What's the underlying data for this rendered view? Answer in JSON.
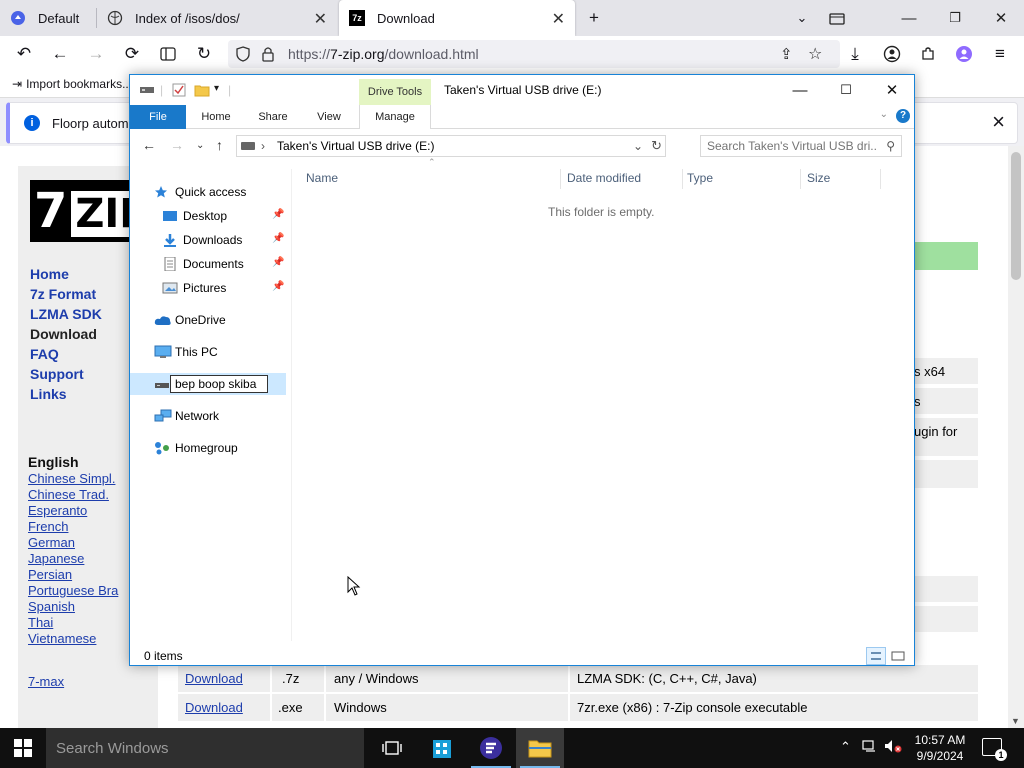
{
  "browser": {
    "tabs": [
      {
        "label": "Default"
      },
      {
        "label": "Index of /isos/dos/"
      },
      {
        "label": "Download"
      }
    ],
    "url_prefix": "https://",
    "url_domain": "7-zip.org",
    "url_path": "/download.html",
    "bookmarks_import": "Import bookmarks...",
    "notification": "Floorp automati"
  },
  "page": {
    "logo_text": "7ZIP",
    "nav": [
      "Home",
      "7z Format",
      "LZMA SDK",
      "Download",
      "FAQ",
      "Support",
      "Links"
    ],
    "languages_title": "English",
    "languages": [
      "Chinese Simpl.",
      "Chinese Trad.",
      "Esperanto",
      "French",
      "German",
      "Japanese",
      "Persian",
      "Portuguese Bra",
      "Spanish",
      "Thai",
      "Vietnamese"
    ],
    "sevenmax": "7-max",
    "peek": [
      "s x64",
      "s",
      "ugin for"
    ],
    "rows": [
      {
        "link": "Download",
        "type": ".7z",
        "os": "any / Windows",
        "desc": "LZMA SDK: (C, C++, C#, Java)"
      },
      {
        "link": "Download",
        "type": ".exe",
        "os": "Windows",
        "desc": "7zr.exe (x86) : 7-Zip console executable"
      }
    ]
  },
  "explorer": {
    "contextual_tab": "Drive Tools",
    "title": "Taken's Virtual USB drive (E:)",
    "ribbon_tabs": [
      "File",
      "Home",
      "Share",
      "View",
      "Manage"
    ],
    "address_path": "Taken's Virtual USB drive (E:)",
    "search_placeholder": "Search Taken's Virtual USB dri...",
    "nav": {
      "quick_access": "Quick access",
      "desktop": "Desktop",
      "downloads": "Downloads",
      "documents": "Documents",
      "pictures": "Pictures",
      "onedrive": "OneDrive",
      "this_pc": "This PC",
      "rename_value": "bep boop skiba",
      "network": "Network",
      "homegroup": "Homegroup"
    },
    "columns": [
      "Name",
      "Date modified",
      "Type",
      "Size"
    ],
    "empty_message": "This folder is empty.",
    "status": "0 items"
  },
  "taskbar": {
    "search_placeholder": "Search Windows",
    "time": "10:57 AM",
    "date": "9/9/2024",
    "notifications": "1"
  }
}
